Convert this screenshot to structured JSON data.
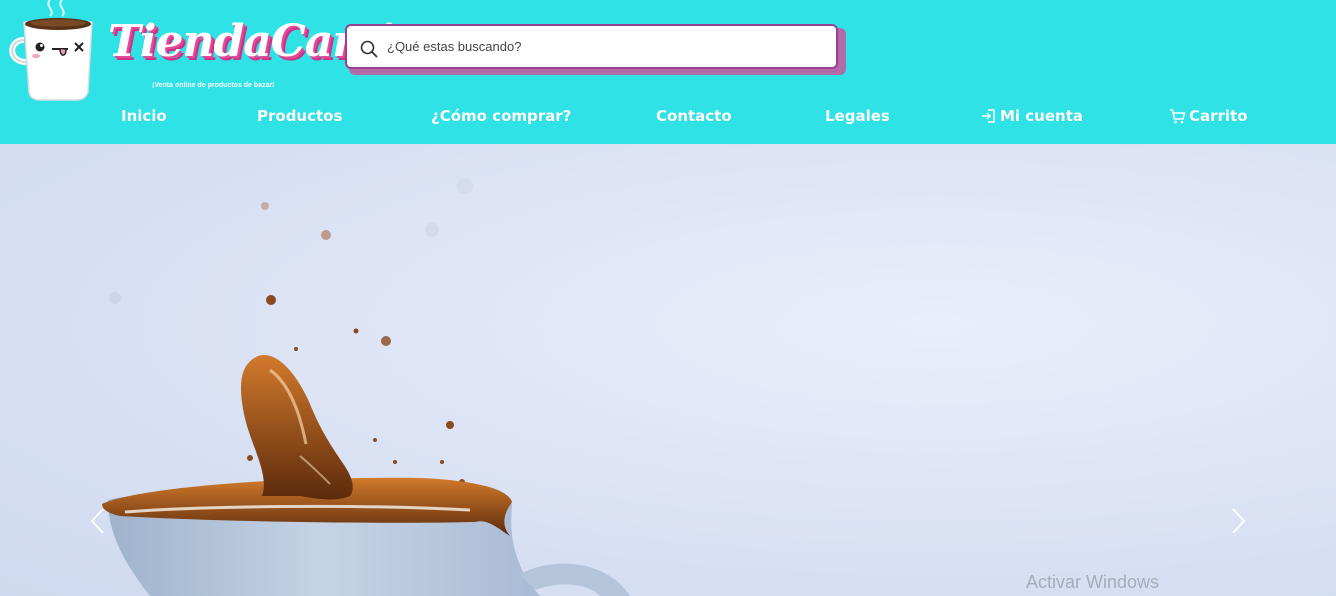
{
  "brand": {
    "name": "TiendaCami",
    "tagline": "¡Venta online de productos de bazar!"
  },
  "search": {
    "placeholder": "¿Qué estas buscando?",
    "value": ""
  },
  "nav": {
    "items": [
      {
        "label": "Inicio"
      },
      {
        "label": "Productos"
      },
      {
        "label": "¿Cómo comprar?"
      },
      {
        "label": "Contacto"
      },
      {
        "label": "Legales"
      },
      {
        "label": "Mi cuenta",
        "icon": "login-icon"
      },
      {
        "label": "Carrito",
        "icon": "cart-icon"
      }
    ]
  },
  "hero": {
    "image": "coffee-splash-cup"
  },
  "carousel": {
    "prev_icon": "chevron-left-icon",
    "next_icon": "chevron-right-icon"
  },
  "watermark": "Activar Windows",
  "colors": {
    "header_bg": "#2ee2e6",
    "brand_pink": "#e8489a",
    "search_border": "#9b3f92",
    "hero_bg": "#dbe3f5"
  }
}
